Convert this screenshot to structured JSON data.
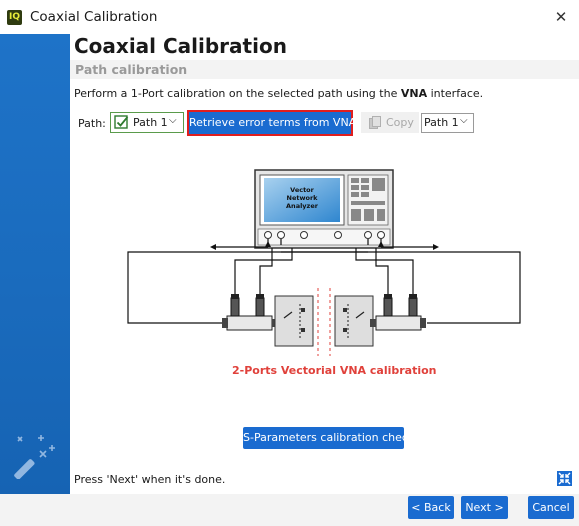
{
  "window": {
    "app_logo_text": "IQ",
    "title": "Coaxial Calibration",
    "close_glyph": "✕"
  },
  "header": {
    "title": "Coaxial Calibration",
    "subtitle": "Path calibration"
  },
  "instructions": {
    "prefix": "Perform a 1-Port calibration on the selected path using the ",
    "emphasis": "VNA",
    "suffix": " interface."
  },
  "toolbar": {
    "path_label": "Path:",
    "path_left_value": "Path 1",
    "retrieve_label": "Retrieve error terms from VNA",
    "copy_label": "Copy",
    "path_right_value": "Path 1",
    "chevron_glyph": "⌵"
  },
  "diagram": {
    "instrument_label_line1": "Vector",
    "instrument_label_line2": "Network",
    "instrument_label_line3": "Analyzer",
    "caption": "2-Ports Vectorial VNA calibration"
  },
  "sparam_button_label": "S-Parameters calibration check",
  "status_text": "Press 'Next' when it's done.",
  "footer": {
    "back_label": "< Back",
    "next_label": "Next >",
    "cancel_label": "Cancel"
  },
  "icons": {
    "app_logo": "iq-logo-icon",
    "close": "close-icon",
    "wizard": "magic-wand-icon",
    "valid": "checkmark-icon",
    "copy": "copy-icon",
    "collapse": "collapse-arrows-icon"
  },
  "colors": {
    "accent": "#1a6bd0",
    "sidebar": "#1a6bbd",
    "highlight_border": "#e01e1e",
    "caption": "#e0413b",
    "valid_green": "#5a9b4b"
  }
}
